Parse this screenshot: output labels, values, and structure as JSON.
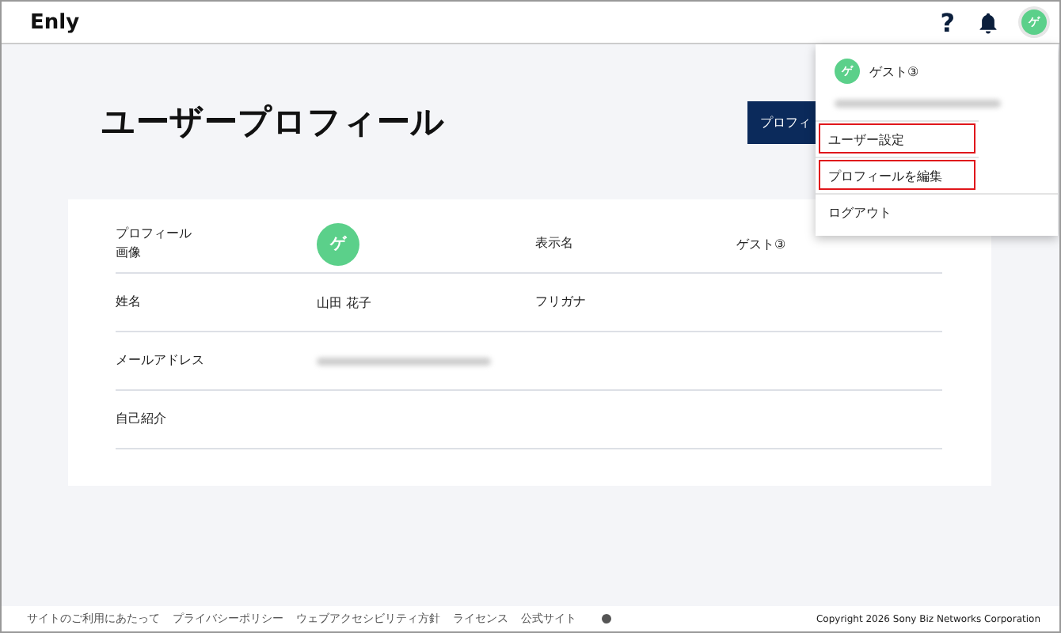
{
  "header": {
    "logo": "Enly",
    "help": "?",
    "avatar": "ゲ"
  },
  "page": {
    "title": "ユーザープロフィール",
    "button": "プロフィ"
  },
  "profile": {
    "rows": [
      {
        "cells": [
          {
            "label": "プロフィール画像",
            "kind": "avatar",
            "value": "ゲ"
          },
          {
            "label": "表示名",
            "kind": "text",
            "value": "ゲスト③"
          }
        ]
      },
      {
        "cells": [
          {
            "label": "姓名",
            "kind": "text",
            "value": "山田 花子"
          },
          {
            "label": "フリガナ",
            "kind": "text"
          }
        ]
      },
      {
        "cells": [
          {
            "label": "メールアドレス",
            "kind": "blurred"
          }
        ]
      },
      {
        "cells": [
          {
            "label": "自己紹介",
            "kind": "text"
          }
        ]
      }
    ]
  },
  "menu": {
    "avatar": "ゲ",
    "name": "ゲスト③",
    "items": [
      {
        "label": "ユーザー設定",
        "highlighted": true
      },
      {
        "label": "プロフィールを編集",
        "highlighted": true
      },
      {
        "label": "ログアウト",
        "highlighted": false
      }
    ]
  },
  "footer": {
    "links": [
      "サイトのご利用にあたって",
      "プライバシーポリシー",
      "ウェブアクセシビリティ方針",
      "ライセンス",
      "公式サイト"
    ],
    "copyright": "Copyright 2026 Sony Biz Networks Corporation"
  }
}
